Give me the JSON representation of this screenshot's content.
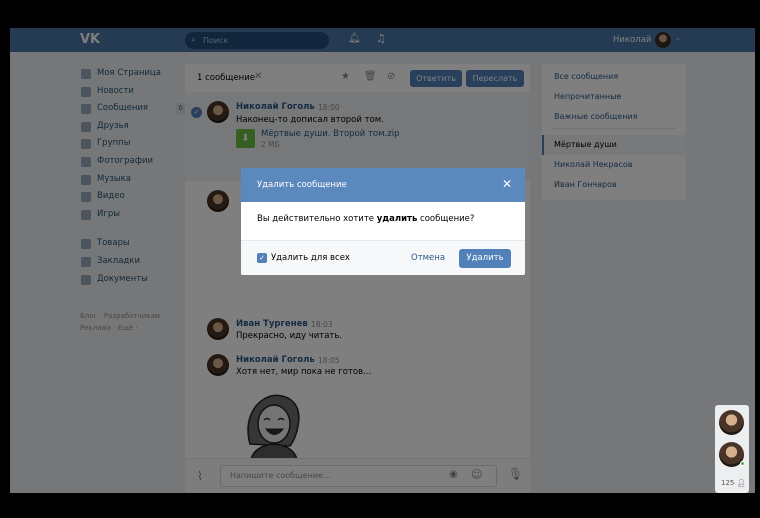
{
  "header": {
    "logo": "VK",
    "search_placeholder": "Поиск",
    "search_icon": "search-icon",
    "user_name": "Николай",
    "caret": "⌄"
  },
  "nav": {
    "items": [
      {
        "label": "Моя Страница",
        "icon": "home-icon"
      },
      {
        "label": "Новости",
        "icon": "news-icon"
      },
      {
        "label": "Сообщения",
        "icon": "messages-icon",
        "badge": "6"
      },
      {
        "label": "Друзья",
        "icon": "friends-icon"
      },
      {
        "label": "Группы",
        "icon": "groups-icon"
      },
      {
        "label": "Фотографии",
        "icon": "photos-icon"
      },
      {
        "label": "Музыка",
        "icon": "music-icon"
      },
      {
        "label": "Видео",
        "icon": "video-icon"
      },
      {
        "label": "Игры",
        "icon": "games-icon"
      }
    ],
    "items2": [
      {
        "label": "Товары",
        "icon": "goods-icon"
      },
      {
        "label": "Закладки",
        "icon": "bookmarks-icon"
      },
      {
        "label": "Документы",
        "icon": "documents-icon"
      }
    ],
    "footer_line1": "Блог · Разработчикам",
    "footer_line2": "Реклама · Ещё ·"
  },
  "chat": {
    "selected_count": "1 сообщение",
    "reply_label": "Ответить",
    "forward_label": "Переслать",
    "messages": [
      {
        "name": "Николай Гоголь",
        "time": "18:00",
        "text": "Наконец-то дописал второй том.",
        "file_name": "Мёртвые души. Второй том.zip",
        "file_size": "2 МБ"
      },
      {
        "name": "Иван Тургенев",
        "time": "18:03",
        "text": "Прекрасно, иду читать."
      },
      {
        "name": "Николай Гоголь",
        "time": "18:05",
        "text": "Хотя нет, мир пока не готов..."
      }
    ],
    "composer_placeholder": "Напишите сообщение..."
  },
  "right_panel": {
    "items": [
      "Все сообщения",
      "Непрочитанные",
      "Важные сообщения"
    ],
    "conversations": [
      "Мёртвые души",
      "Николай Некрасов",
      "Иван Гончаров"
    ],
    "active": "Мёртвые души"
  },
  "dialog": {
    "title": "Удалить сообщение",
    "body_prefix": "Вы действительно хотите ",
    "body_bold": "удалить",
    "body_suffix": " сообщение?",
    "checkbox_label": "Удалить для всех",
    "checkbox_checked": true,
    "cancel_label": "Отмена",
    "ok_label": "Удалить"
  },
  "float_panel": {
    "count": "125"
  },
  "colors": {
    "header": "#4a76a8",
    "accent": "#5181b8",
    "link": "#2a5885"
  }
}
